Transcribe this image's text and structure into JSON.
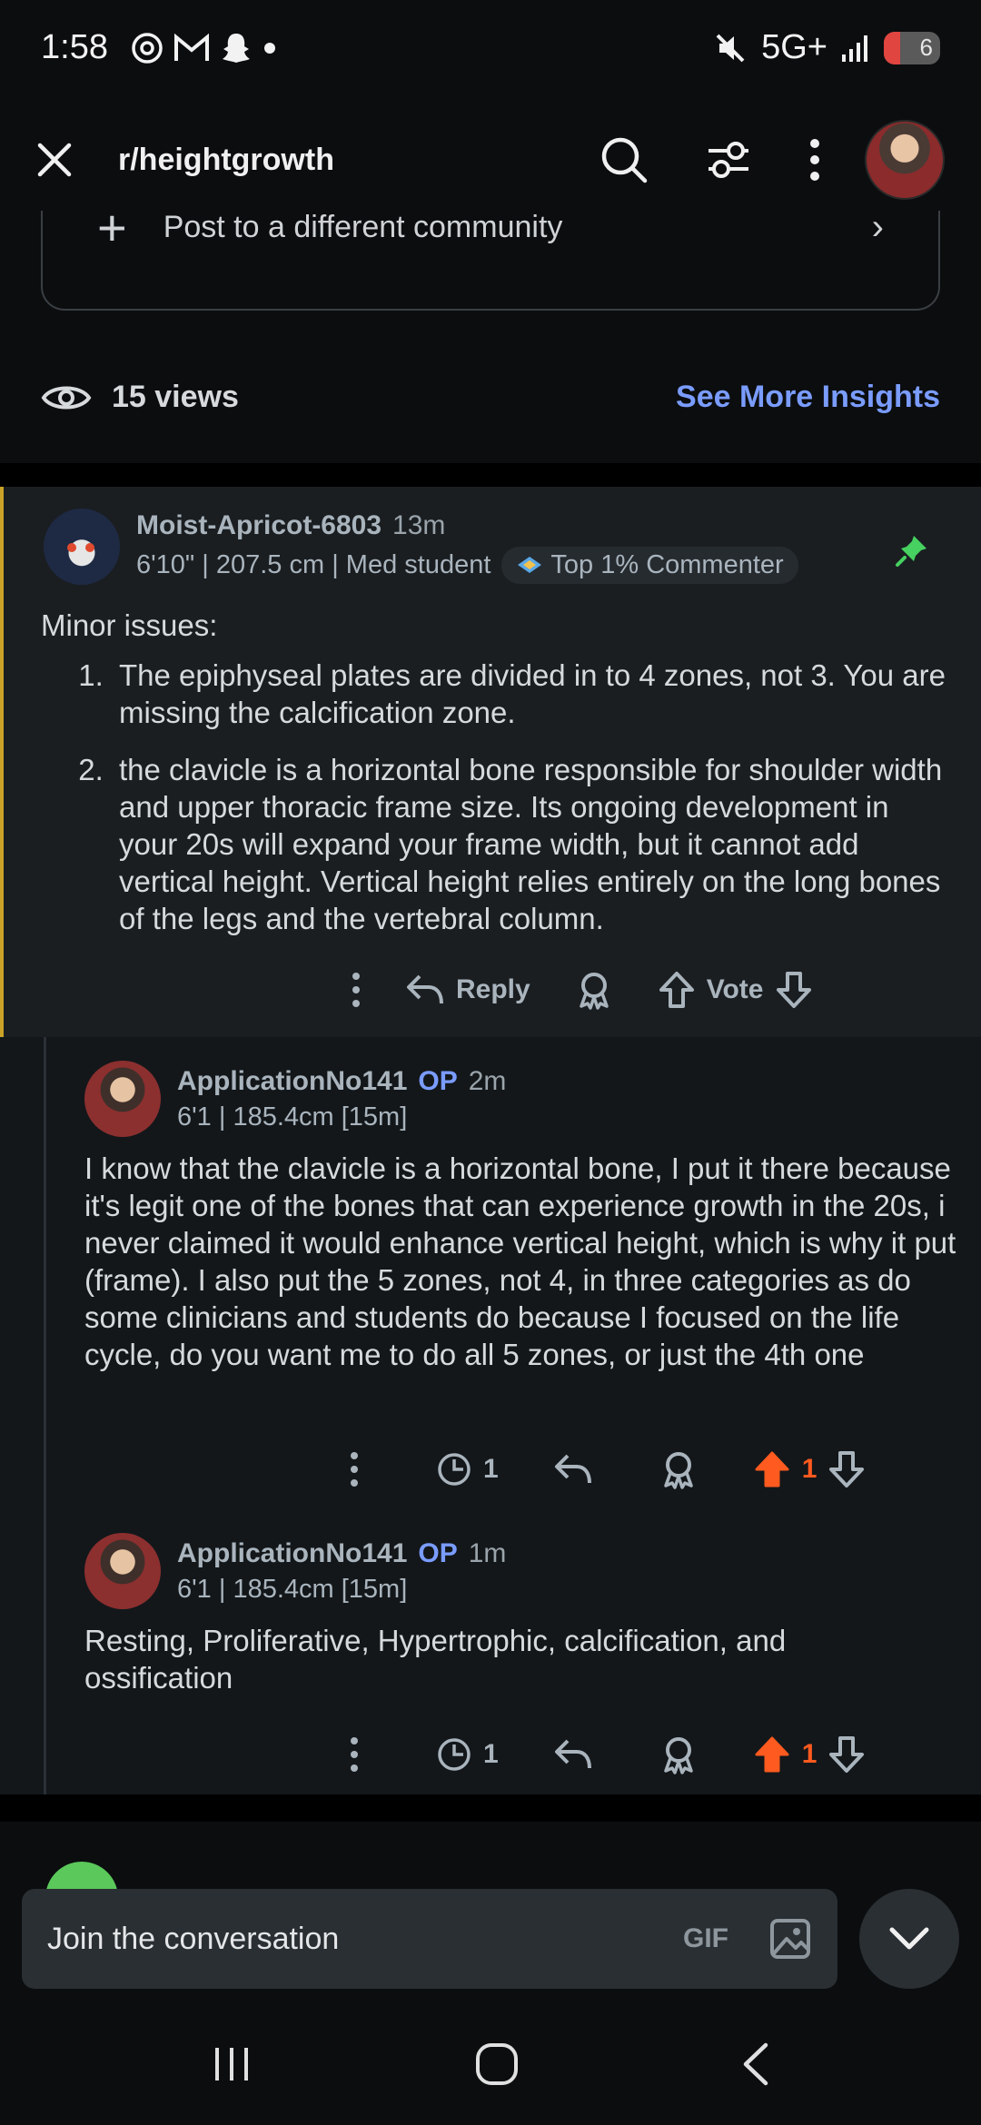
{
  "status_bar": {
    "time": "1:58",
    "network": "5G+",
    "battery_level": "6"
  },
  "header": {
    "title": "r/heightgrowth"
  },
  "community": {
    "label": "Post to a different community"
  },
  "insights": {
    "views": "15 views",
    "see_more": "See More Insights"
  },
  "comments": [
    {
      "username": "Moist-Apricot-6803",
      "time": "13m",
      "flair": "6'10\" | 207.5 cm | Med student",
      "badge": "Top 1% Commenter",
      "intro": "Minor issues:",
      "points": [
        "The epiphyseal plates are divided in to 4 zones, not 3. You are missing the calcification zone.",
        "the clavicle is a horizontal bone responsible for shoulder width and upper thoracic frame size. Its ongoing development in your 20s will expand your frame width, but it cannot add vertical height. Vertical height relies entirely on the long bones of the legs and the vertebral column."
      ],
      "reply_label": "Reply",
      "vote_label": "Vote",
      "accent_color": "#c9a227"
    },
    {
      "username": "ApplicationNo141",
      "op": "OP",
      "time": "2m",
      "flair": "6'1 | 185.4cm [15m]",
      "body": "I know that the clavicle is a horizontal bone, I put it there because it's legit one of the bones that can experience growth in the 20s, i never claimed it would enhance vertical height, which is why it put (frame). I also put the 5 zones, not 4, in three categories as do some clinicians and students do because I focused on the life cycle, do you want me to do all 5 zones, or just the 4th one",
      "history_count": "1",
      "score": "1"
    },
    {
      "username": "ApplicationNo141",
      "op": "OP",
      "time": "1m",
      "flair": "6'1 | 185.4cm [15m]",
      "body": "Resting, Proliferative, Hypertrophic, calcification, and ossification",
      "history_count": "1",
      "score": "1"
    }
  ],
  "composer": {
    "placeholder": "Join the conversation",
    "gif_label": "GIF"
  },
  "colors": {
    "upvote": "#ff5a1f",
    "op": "#7a9cff",
    "link": "#7a9cff",
    "pin": "#46d160"
  }
}
